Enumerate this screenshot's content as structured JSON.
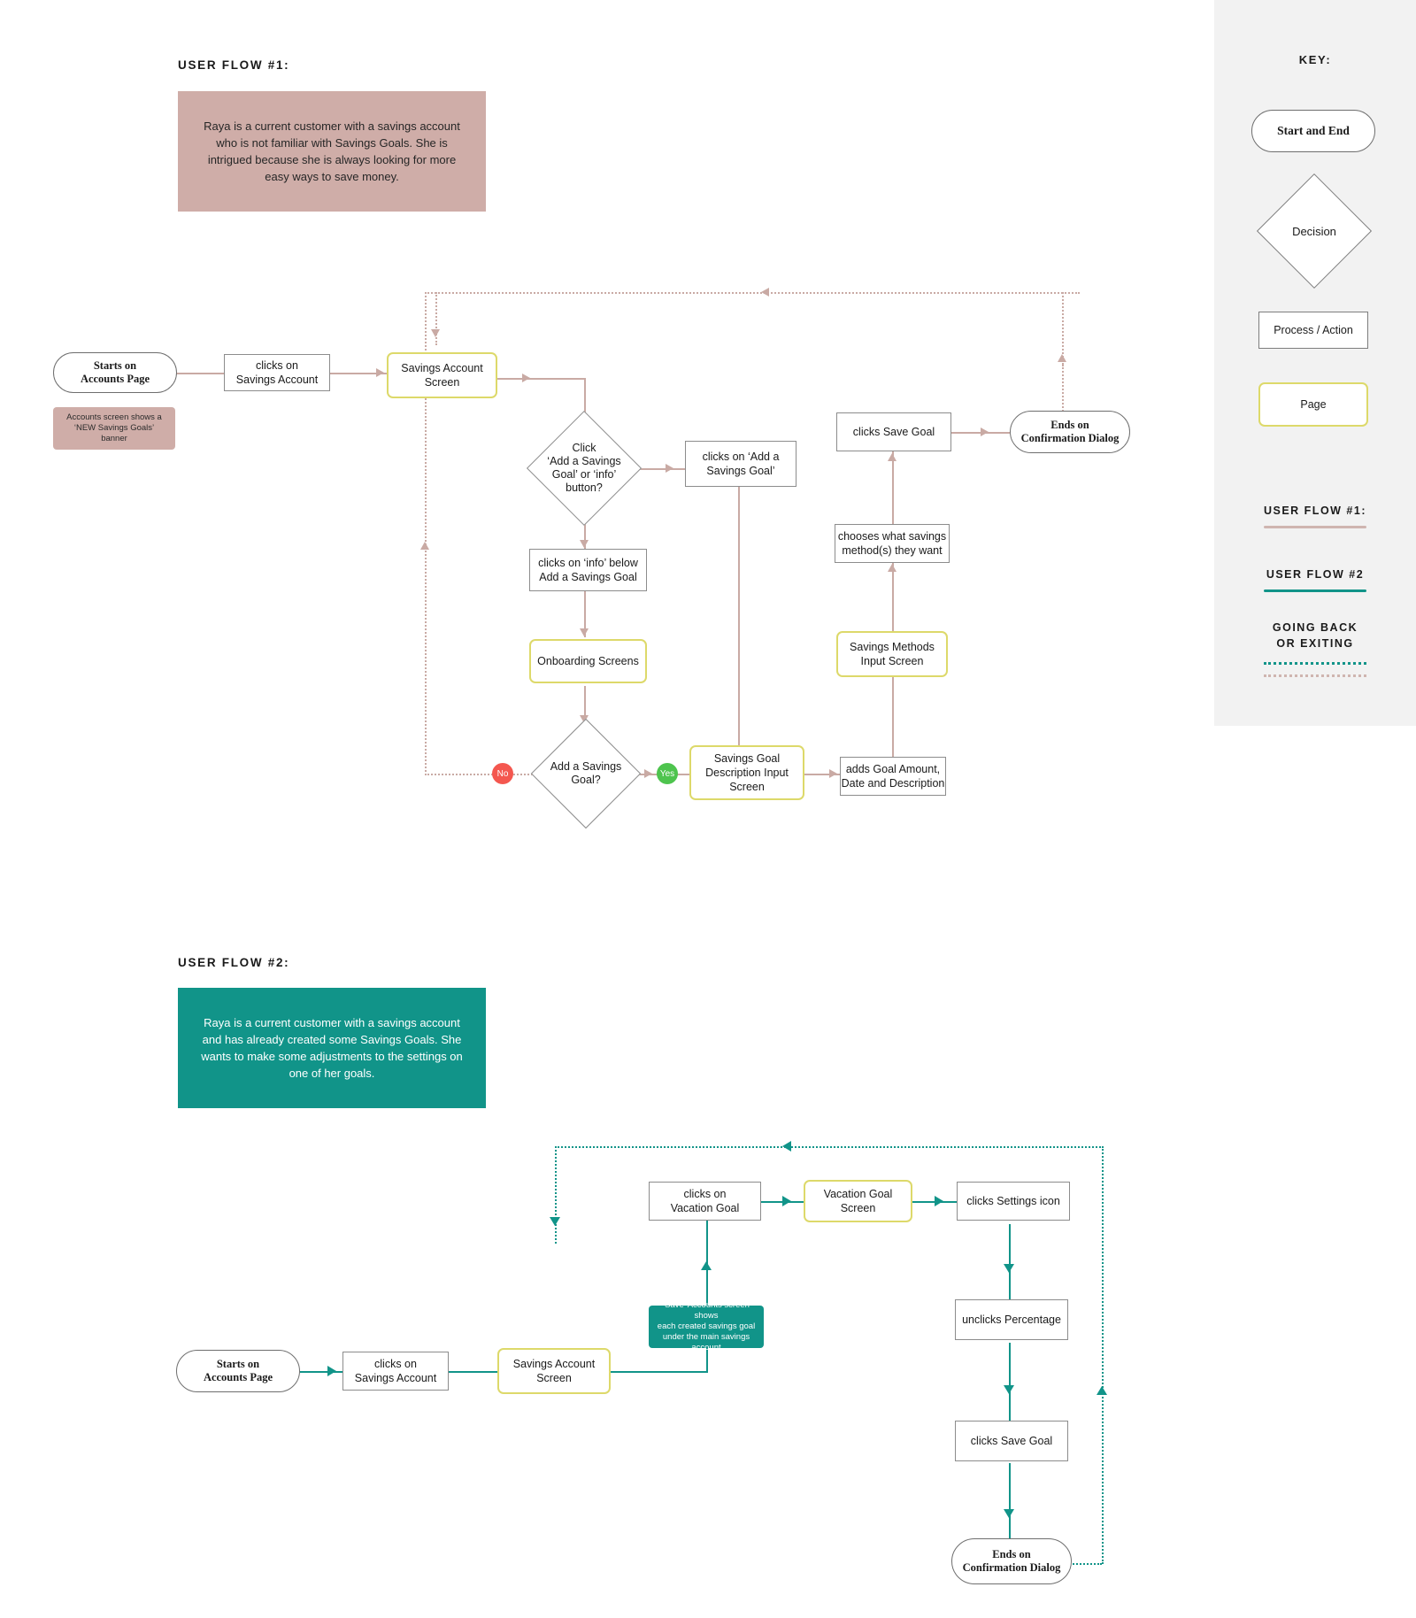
{
  "key": {
    "title": "KEY:",
    "shapes": [
      {
        "name": "terminator",
        "label": "Start and End"
      },
      {
        "name": "decision",
        "label": "Decision"
      },
      {
        "name": "process",
        "label": "Process / Action"
      },
      {
        "name": "page",
        "label": "Page"
      }
    ],
    "legend_lines": [
      {
        "label": "USER FLOW #1:",
        "color": "#cfb5b0",
        "style": "solid"
      },
      {
        "label": "USER FLOW #2",
        "color": "#119489",
        "style": "solid"
      },
      {
        "label": "GOING BACK\nOR EXITING",
        "color": "#119489",
        "style": "dotted"
      }
    ],
    "going_back_label_line1": "GOING BACK",
    "going_back_label_line2": "OR EXITING",
    "colors": {
      "flow1": "#c9aaa4",
      "flow2": "#119489",
      "page_border": "#ddd96a",
      "persona1_bg": "#cfada8",
      "persona2_bg": "#119489",
      "panel_bg": "#f2f2f2"
    }
  },
  "flow1": {
    "title": "USER FLOW #1:",
    "persona": "Raya is a current customer with a savings account who is not familiar with Savings Goals. She is intrigued because she is always looking for more easy ways to save money.",
    "nodes": {
      "start": "Starts on\nAccounts Page",
      "start_line1": "Starts on",
      "start_line2": "Accounts Page",
      "start_note": "Accounts screen shows a ‘NEW Savings Goals’ banner",
      "start_note_l1": "Accounts screen shows a",
      "start_note_l2": "‘NEW Savings Goals’",
      "start_note_l3": "banner",
      "clicks_savings_account": "clicks on\nSavings Account",
      "clicks_savings_account_l1": "clicks on",
      "clicks_savings_account_l2": "Savings Account",
      "savings_account_screen": "Savings Account\nScreen",
      "savings_account_screen_l1": "Savings Account",
      "savings_account_screen_l2": "Screen",
      "decision_click": "Click ‘Add a Savings Goal’ or ‘info’ button?",
      "decision_click_l1": "Click",
      "decision_click_l2": "‘Add a Savings",
      "decision_click_l3": "Goal’ or ‘info’",
      "decision_click_l4": "button?",
      "clicks_add_goal": "clicks on ‘Add a\nSavings Goal’",
      "clicks_add_goal_l1": "clicks on ‘Add a",
      "clicks_add_goal_l2": "Savings Goal’",
      "clicks_info": "clicks on ‘info’ below\nAdd a Savings Goal",
      "clicks_info_l1": "clicks on ‘info’ below",
      "clicks_info_l2": "Add a Savings Goal",
      "onboarding": "Onboarding Screens",
      "decision_add_goal_l1": "Add a Savings",
      "decision_add_goal_l2": "Goal?",
      "badge_no": "No",
      "badge_yes": "Yes",
      "goal_description_screen_l1": "Savings Goal",
      "goal_description_screen_l2": "Description Input",
      "goal_description_screen_l3": "Screen",
      "adds_goal_amount_l1": "adds Goal Amount,",
      "adds_goal_amount_l2": "Date and Description",
      "savings_methods_screen_l1": "Savings Methods",
      "savings_methods_screen_l2": "Input Screen",
      "chooses_methods_l1": "chooses what savings",
      "chooses_methods_l2": "method(s) they want",
      "clicks_save_goal": "clicks Save Goal",
      "end_l1": "Ends on",
      "end_l2": "Confirmation Dialog"
    }
  },
  "flow2": {
    "title": "USER FLOW #2:",
    "persona": "Raya is a current customer with a savings account and has already created some Savings Goals. She wants to make some adjustments to the settings on one of her goals.",
    "nodes": {
      "start_line1": "Starts on",
      "start_line2": "Accounts Page",
      "clicks_savings_account_l1": "clicks on",
      "clicks_savings_account_l2": "Savings Account",
      "savings_account_screen_l1": "Savings Account",
      "savings_account_screen_l2": "Screen",
      "save_note_l1": "‘Save’ Accounts screen shows",
      "save_note_l2": "each created savings goal",
      "save_note_l3": "under the main savings account",
      "clicks_vacation_goal_l1": "clicks on",
      "clicks_vacation_goal_l2": "Vacation Goal",
      "vacation_goal_screen": "Vacation Goal Screen",
      "clicks_settings_icon": "clicks Settings icon",
      "unclicks_percentage": "unclicks Percentage",
      "clicks_save_goal": "clicks Save Goal",
      "end_l1": "Ends on",
      "end_l2": "Confirmation Dialog"
    }
  }
}
